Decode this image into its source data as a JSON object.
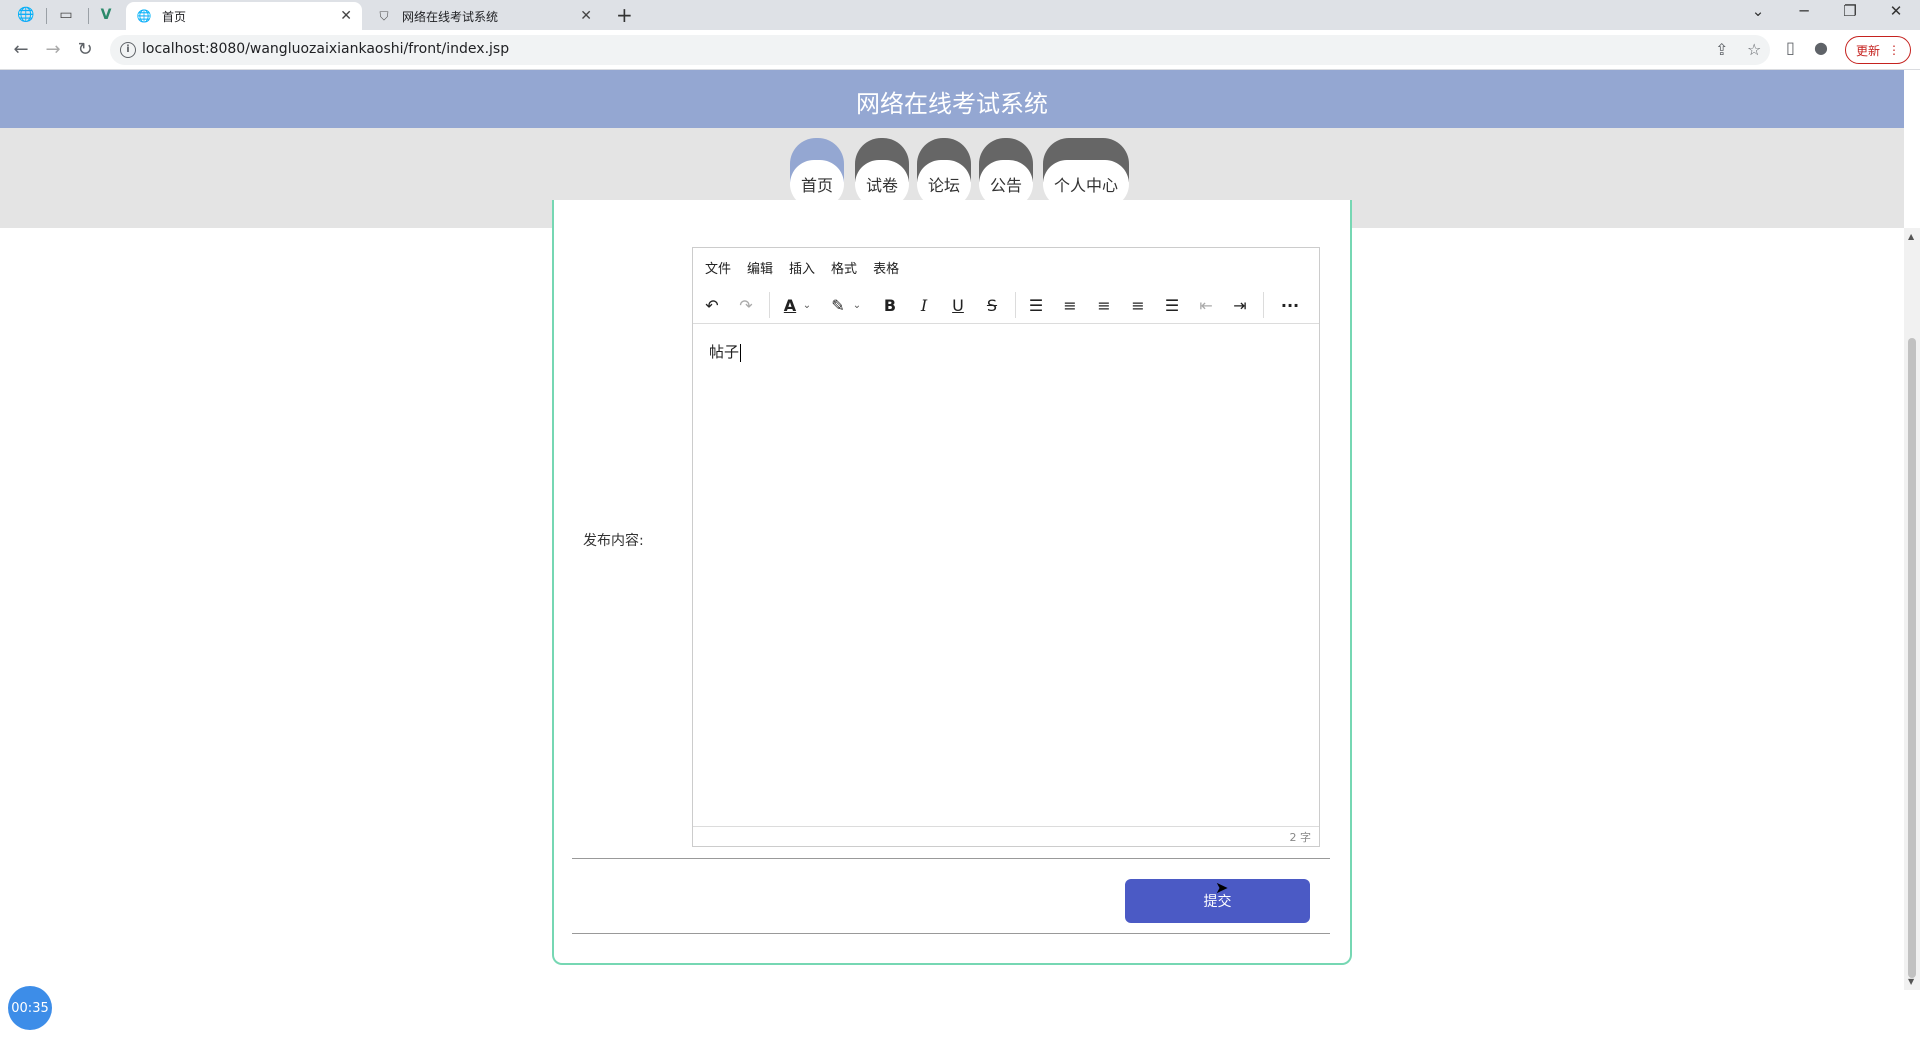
{
  "browser": {
    "tabs": [
      {
        "title": "首页",
        "active": true
      },
      {
        "title": "网络在线考试系统",
        "active": false
      }
    ],
    "url": "localhost:8080/wangluozaixiankaoshi/front/index.jsp",
    "update_label": "更新",
    "new_tab_symbol": "+"
  },
  "site": {
    "title": "网络在线考试系统",
    "nav": [
      {
        "label": "首页",
        "active": true
      },
      {
        "label": "试卷",
        "active": false
      },
      {
        "label": "论坛",
        "active": false
      },
      {
        "label": "公告",
        "active": false
      },
      {
        "label": "个人中心",
        "active": false
      }
    ],
    "accent_color": "#94a7d2",
    "nav_inactive_color": "#666666"
  },
  "form": {
    "content_label": "发布内容:",
    "submit_label": "提交"
  },
  "editor": {
    "menus": [
      "文件",
      "编辑",
      "插入",
      "格式",
      "表格"
    ],
    "content": "帖子",
    "word_count": "2 字",
    "tools": [
      "undo-icon",
      "redo-icon",
      "font-color-icon",
      "highlight-icon",
      "bold-icon",
      "italic-icon",
      "underline-icon",
      "strikethrough-icon",
      "line-height-icon",
      "align-left-icon",
      "align-center-icon",
      "align-right-icon",
      "align-justify-icon",
      "outdent-icon",
      "indent-icon",
      "more-icon"
    ]
  },
  "timer": "00:35"
}
